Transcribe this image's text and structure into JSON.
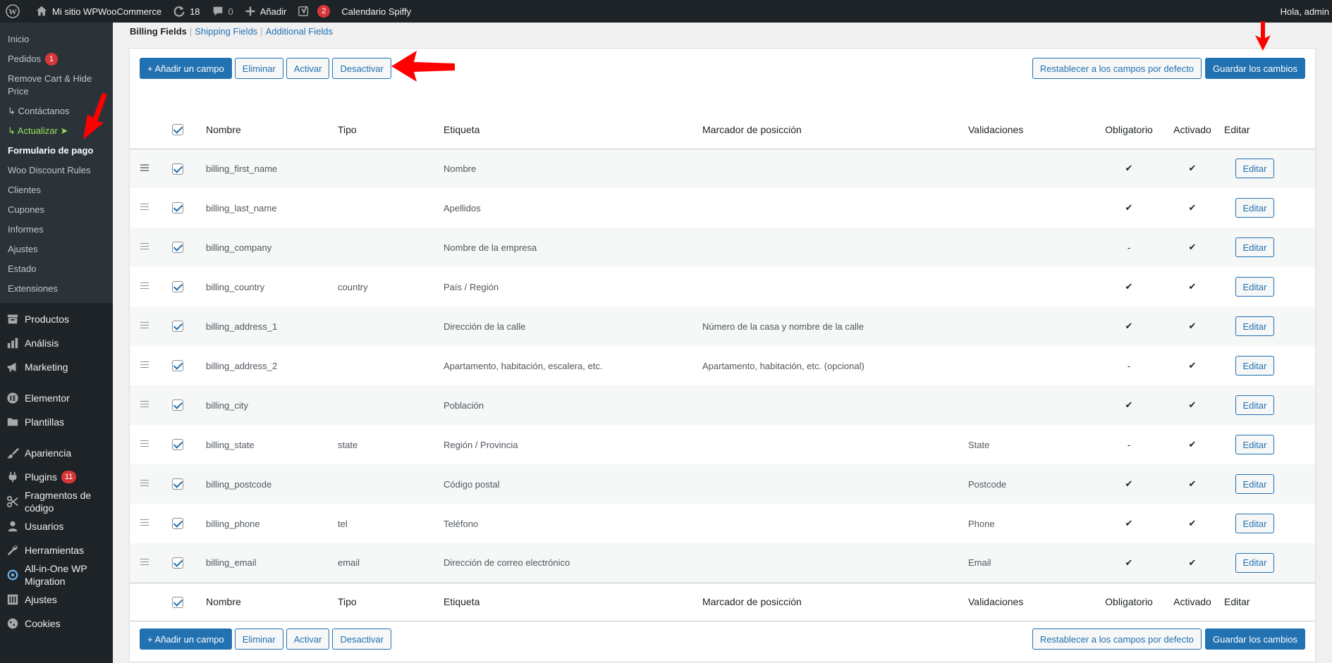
{
  "adminbar": {
    "site_name": "Mi sitio WPWooCommerce",
    "updates_count": "18",
    "comments_count": "0",
    "add_label": "Añadir",
    "yoast_count": "2",
    "calendar_label": "Calendario Spiffy",
    "greeting": "Hola, admin"
  },
  "sidebar": {
    "submenu": [
      {
        "label": "Inicio"
      },
      {
        "label": "Pedidos",
        "badge": "1"
      },
      {
        "label": "Remove Cart & Hide Price"
      },
      {
        "label": "↳ Contáctanos"
      },
      {
        "label": "↳ Actualizar ➤"
      },
      {
        "label": "Formulario de pago"
      },
      {
        "label": "Woo Discount Rules"
      },
      {
        "label": "Clientes"
      },
      {
        "label": "Cupones"
      },
      {
        "label": "Informes"
      },
      {
        "label": "Ajustes"
      },
      {
        "label": "Estado"
      },
      {
        "label": "Extensiones"
      }
    ],
    "menu": [
      {
        "label": "Productos",
        "icon": "archive-icon"
      },
      {
        "label": "Análisis",
        "icon": "bar-chart-icon"
      },
      {
        "label": "Marketing",
        "icon": "megaphone-icon"
      },
      {
        "label": "Elementor",
        "icon": "elementor-icon"
      },
      {
        "label": "Plantillas",
        "icon": "folder-icon"
      },
      {
        "label": "Apariencia",
        "icon": "brush-icon"
      },
      {
        "label": "Plugins",
        "icon": "plug-icon",
        "badge": "11"
      },
      {
        "label": "Fragmentos de código",
        "icon": "scissors-icon"
      },
      {
        "label": "Usuarios",
        "icon": "user-icon"
      },
      {
        "label": "Herramientas",
        "icon": "wrench-icon"
      },
      {
        "label": "All-in-One WP Migration",
        "icon": "migration-icon"
      },
      {
        "label": "Ajustes",
        "icon": "settings-icon"
      },
      {
        "label": "Cookies",
        "icon": "cookie-icon"
      }
    ]
  },
  "tabs": {
    "billing": "Billing Fields",
    "shipping": "Shipping Fields",
    "additional": "Additional Fields"
  },
  "toolbar": {
    "add_field": "+ Añadir un campo",
    "remove": "Eliminar",
    "enable": "Activar",
    "disable": "Desactivar",
    "reset": "Restablecer a los campos por defecto",
    "save": "Guardar los cambios"
  },
  "table": {
    "headers": {
      "name": "Nombre",
      "type": "Tipo",
      "label": "Etiqueta",
      "placeholder": "Marcador de posicción",
      "validations": "Validaciones",
      "required": "Obligatorio",
      "enabled": "Activado",
      "edit": "Editar"
    },
    "edit_label": "Editar",
    "rows": [
      {
        "name": "billing_first_name",
        "type": "",
        "label": "Nombre",
        "placeholder": "",
        "validation": "",
        "required": "✔",
        "enabled": "✔"
      },
      {
        "name": "billing_last_name",
        "type": "",
        "label": "Apellidos",
        "placeholder": "",
        "validation": "",
        "required": "✔",
        "enabled": "✔"
      },
      {
        "name": "billing_company",
        "type": "",
        "label": "Nombre de la empresa",
        "placeholder": "",
        "validation": "",
        "required": "-",
        "enabled": "✔"
      },
      {
        "name": "billing_country",
        "type": "country",
        "label": "País / Región",
        "placeholder": "",
        "validation": "",
        "required": "✔",
        "enabled": "✔"
      },
      {
        "name": "billing_address_1",
        "type": "",
        "label": "Dirección de la calle",
        "placeholder": "Número de la casa y nombre de la calle",
        "validation": "",
        "required": "✔",
        "enabled": "✔"
      },
      {
        "name": "billing_address_2",
        "type": "",
        "label": "Apartamento, habitación, escalera, etc.",
        "placeholder": "Apartamento, habitación, etc. (opcional)",
        "validation": "",
        "required": "-",
        "enabled": "✔"
      },
      {
        "name": "billing_city",
        "type": "",
        "label": "Población",
        "placeholder": "",
        "validation": "",
        "required": "✔",
        "enabled": "✔"
      },
      {
        "name": "billing_state",
        "type": "state",
        "label": "Región / Provincia",
        "placeholder": "",
        "validation": "State",
        "required": "-",
        "enabled": "✔"
      },
      {
        "name": "billing_postcode",
        "type": "",
        "label": "Código postal",
        "placeholder": "",
        "validation": "Postcode",
        "required": "✔",
        "enabled": "✔"
      },
      {
        "name": "billing_phone",
        "type": "tel",
        "label": "Teléfono",
        "placeholder": "",
        "validation": "Phone",
        "required": "✔",
        "enabled": "✔"
      },
      {
        "name": "billing_email",
        "type": "email",
        "label": "Dirección de correo electrónico",
        "placeholder": "",
        "validation": "Email",
        "required": "✔",
        "enabled": "✔"
      }
    ]
  },
  "colors": {
    "accent": "#2271b1",
    "sidebar_bg": "#1d2327",
    "badge": "#d63638",
    "annotation_arrow": "#ff0000"
  }
}
